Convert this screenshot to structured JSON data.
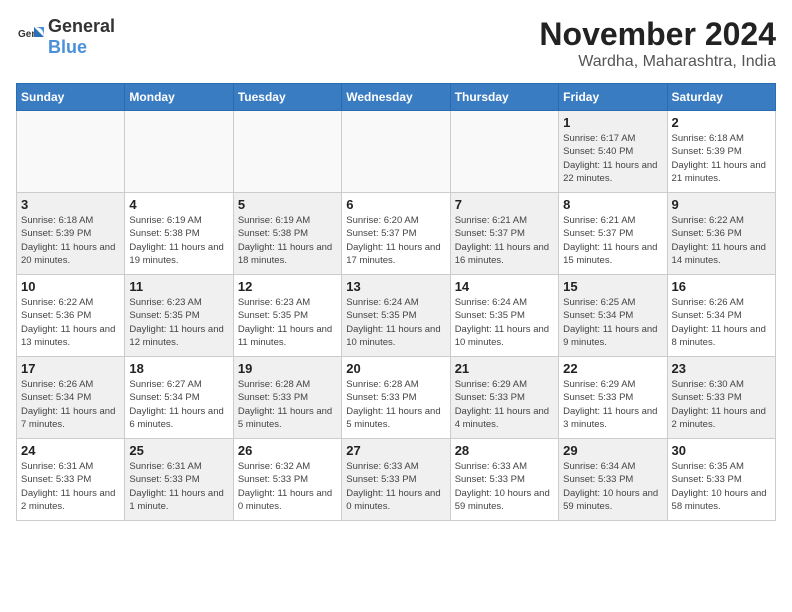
{
  "header": {
    "logo_general": "General",
    "logo_blue": "Blue",
    "month": "November 2024",
    "location": "Wardha, Maharashtra, India"
  },
  "days_of_week": [
    "Sunday",
    "Monday",
    "Tuesday",
    "Wednesday",
    "Thursday",
    "Friday",
    "Saturday"
  ],
  "weeks": [
    [
      {
        "day": "",
        "empty": true
      },
      {
        "day": "",
        "empty": true
      },
      {
        "day": "",
        "empty": true
      },
      {
        "day": "",
        "empty": true
      },
      {
        "day": "",
        "empty": true
      },
      {
        "day": "1",
        "sunrise": "6:17 AM",
        "sunset": "5:40 PM",
        "daylight": "11 hours and 22 minutes."
      },
      {
        "day": "2",
        "sunrise": "6:18 AM",
        "sunset": "5:39 PM",
        "daylight": "11 hours and 21 minutes."
      }
    ],
    [
      {
        "day": "3",
        "sunrise": "6:18 AM",
        "sunset": "5:39 PM",
        "daylight": "11 hours and 20 minutes."
      },
      {
        "day": "4",
        "sunrise": "6:19 AM",
        "sunset": "5:38 PM",
        "daylight": "11 hours and 19 minutes."
      },
      {
        "day": "5",
        "sunrise": "6:19 AM",
        "sunset": "5:38 PM",
        "daylight": "11 hours and 18 minutes."
      },
      {
        "day": "6",
        "sunrise": "6:20 AM",
        "sunset": "5:37 PM",
        "daylight": "11 hours and 17 minutes."
      },
      {
        "day": "7",
        "sunrise": "6:21 AM",
        "sunset": "5:37 PM",
        "daylight": "11 hours and 16 minutes."
      },
      {
        "day": "8",
        "sunrise": "6:21 AM",
        "sunset": "5:37 PM",
        "daylight": "11 hours and 15 minutes."
      },
      {
        "day": "9",
        "sunrise": "6:22 AM",
        "sunset": "5:36 PM",
        "daylight": "11 hours and 14 minutes."
      }
    ],
    [
      {
        "day": "10",
        "sunrise": "6:22 AM",
        "sunset": "5:36 PM",
        "daylight": "11 hours and 13 minutes."
      },
      {
        "day": "11",
        "sunrise": "6:23 AM",
        "sunset": "5:35 PM",
        "daylight": "11 hours and 12 minutes."
      },
      {
        "day": "12",
        "sunrise": "6:23 AM",
        "sunset": "5:35 PM",
        "daylight": "11 hours and 11 minutes."
      },
      {
        "day": "13",
        "sunrise": "6:24 AM",
        "sunset": "5:35 PM",
        "daylight": "11 hours and 10 minutes."
      },
      {
        "day": "14",
        "sunrise": "6:24 AM",
        "sunset": "5:35 PM",
        "daylight": "11 hours and 10 minutes."
      },
      {
        "day": "15",
        "sunrise": "6:25 AM",
        "sunset": "5:34 PM",
        "daylight": "11 hours and 9 minutes."
      },
      {
        "day": "16",
        "sunrise": "6:26 AM",
        "sunset": "5:34 PM",
        "daylight": "11 hours and 8 minutes."
      }
    ],
    [
      {
        "day": "17",
        "sunrise": "6:26 AM",
        "sunset": "5:34 PM",
        "daylight": "11 hours and 7 minutes."
      },
      {
        "day": "18",
        "sunrise": "6:27 AM",
        "sunset": "5:34 PM",
        "daylight": "11 hours and 6 minutes."
      },
      {
        "day": "19",
        "sunrise": "6:28 AM",
        "sunset": "5:33 PM",
        "daylight": "11 hours and 5 minutes."
      },
      {
        "day": "20",
        "sunrise": "6:28 AM",
        "sunset": "5:33 PM",
        "daylight": "11 hours and 5 minutes."
      },
      {
        "day": "21",
        "sunrise": "6:29 AM",
        "sunset": "5:33 PM",
        "daylight": "11 hours and 4 minutes."
      },
      {
        "day": "22",
        "sunrise": "6:29 AM",
        "sunset": "5:33 PM",
        "daylight": "11 hours and 3 minutes."
      },
      {
        "day": "23",
        "sunrise": "6:30 AM",
        "sunset": "5:33 PM",
        "daylight": "11 hours and 2 minutes."
      }
    ],
    [
      {
        "day": "24",
        "sunrise": "6:31 AM",
        "sunset": "5:33 PM",
        "daylight": "11 hours and 2 minutes."
      },
      {
        "day": "25",
        "sunrise": "6:31 AM",
        "sunset": "5:33 PM",
        "daylight": "11 hours and 1 minute."
      },
      {
        "day": "26",
        "sunrise": "6:32 AM",
        "sunset": "5:33 PM",
        "daylight": "11 hours and 0 minutes."
      },
      {
        "day": "27",
        "sunrise": "6:33 AM",
        "sunset": "5:33 PM",
        "daylight": "11 hours and 0 minutes."
      },
      {
        "day": "28",
        "sunrise": "6:33 AM",
        "sunset": "5:33 PM",
        "daylight": "10 hours and 59 minutes."
      },
      {
        "day": "29",
        "sunrise": "6:34 AM",
        "sunset": "5:33 PM",
        "daylight": "10 hours and 59 minutes."
      },
      {
        "day": "30",
        "sunrise": "6:35 AM",
        "sunset": "5:33 PM",
        "daylight": "10 hours and 58 minutes."
      }
    ]
  ]
}
